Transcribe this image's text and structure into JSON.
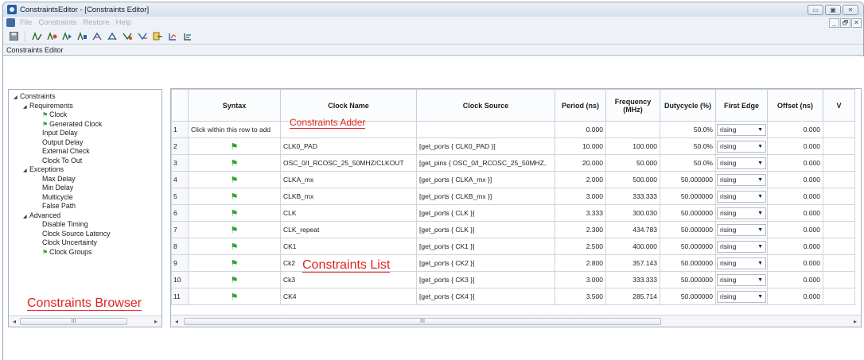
{
  "window": {
    "title": "ConstraintsEditor - [Constraints Editor]",
    "controls": [
      "▭",
      "▣",
      "✕"
    ],
    "mdi_controls": [
      "_",
      "🗗",
      "✕"
    ]
  },
  "menu": [
    "File",
    "Constraints",
    "Restore",
    "Help"
  ],
  "toolbar_icons": [
    "save-icon",
    "tool-1-icon",
    "tool-2-icon",
    "tool-3-icon",
    "tool-4-icon",
    "tool-5-icon",
    "tool-6-icon",
    "tool-7-icon",
    "tool-8-icon",
    "tool-9-icon",
    "tool-10-icon",
    "tool-11-icon"
  ],
  "editor_label": "Constraints Editor",
  "tree": [
    {
      "label": "Constraints",
      "indent": 0,
      "expander": "◢",
      "flag": false
    },
    {
      "label": "Requirements",
      "indent": 1,
      "expander": "◢",
      "flag": false
    },
    {
      "label": "Clock",
      "indent": 3,
      "expander": "",
      "flag": true
    },
    {
      "label": "Generated Clock",
      "indent": 3,
      "expander": "",
      "flag": true
    },
    {
      "label": "Input Delay",
      "indent": 3,
      "expander": "",
      "flag": false
    },
    {
      "label": "Output Delay",
      "indent": 3,
      "expander": "",
      "flag": false
    },
    {
      "label": "External Check",
      "indent": 3,
      "expander": "",
      "flag": false
    },
    {
      "label": "Clock To Out",
      "indent": 3,
      "expander": "",
      "flag": false
    },
    {
      "label": "Exceptions",
      "indent": 1,
      "expander": "◢",
      "flag": false
    },
    {
      "label": "Max Delay",
      "indent": 3,
      "expander": "",
      "flag": false
    },
    {
      "label": "Min Delay",
      "indent": 3,
      "expander": "",
      "flag": false
    },
    {
      "label": "Multicycle",
      "indent": 3,
      "expander": "",
      "flag": false
    },
    {
      "label": "False Path",
      "indent": 3,
      "expander": "",
      "flag": false
    },
    {
      "label": "Advanced",
      "indent": 1,
      "expander": "◢",
      "flag": false
    },
    {
      "label": "Disable Timing",
      "indent": 3,
      "expander": "",
      "flag": false
    },
    {
      "label": "Clock Source Latency",
      "indent": 3,
      "expander": "",
      "flag": false
    },
    {
      "label": "Clock Uncertainty",
      "indent": 3,
      "expander": "",
      "flag": false
    },
    {
      "label": "Clock Groups",
      "indent": 3,
      "expander": "",
      "flag": true
    }
  ],
  "annotations": {
    "browser": "Constraints Browser",
    "adder": "Constraints Adder",
    "list": "Constraints List"
  },
  "scroll_thumb": "III",
  "table": {
    "columns": [
      "Syntax",
      "Clock Name",
      "Clock Source",
      "Period  (ns)",
      "Frequency (MHz)",
      "Dutycycle (%)",
      "First Edge",
      "Offset (ns)",
      "V"
    ],
    "rows": [
      {
        "n": "1",
        "syntax": "Click within this row to add",
        "flag": false,
        "name": "",
        "source": "",
        "period": "0.000",
        "freq": "",
        "duty": "50.0%",
        "edge": "rising",
        "offset": "0.000"
      },
      {
        "n": "2",
        "syntax": "",
        "flag": true,
        "name": "CLK0_PAD",
        "source": "[get_ports { CLK0_PAD }]",
        "period": "10.000",
        "freq": "100.000",
        "duty": "50.0%",
        "edge": "rising",
        "offset": "0.000"
      },
      {
        "n": "3",
        "syntax": "",
        "flag": true,
        "name": "OSC_0/I_RCOSC_25_50MHZ/CLKOUT",
        "source": "[get_pins { OSC_0/I_RCOSC_25_50MHZ,",
        "period": "20.000",
        "freq": "50.000",
        "duty": "50.0%",
        "edge": "rising",
        "offset": "0.000"
      },
      {
        "n": "4",
        "syntax": "",
        "flag": true,
        "name": "CLKA_mx",
        "source": "[get_ports { CLKA_mx }]",
        "period": "2.000",
        "freq": "500.000",
        "duty": "50.000000",
        "edge": "rising",
        "offset": "0.000"
      },
      {
        "n": "5",
        "syntax": "",
        "flag": true,
        "name": "CLKB_mx",
        "source": "[get_ports { CLKB_mx }]",
        "period": "3.000",
        "freq": "333.333",
        "duty": "50.000000",
        "edge": "rising",
        "offset": "0.000"
      },
      {
        "n": "6",
        "syntax": "",
        "flag": true,
        "name": "CLK",
        "source": "[get_ports { CLK }]",
        "period": "3.333",
        "freq": "300.030",
        "duty": "50.000000",
        "edge": "rising",
        "offset": "0.000"
      },
      {
        "n": "7",
        "syntax": "",
        "flag": true,
        "name": "CLK_repeat",
        "source": "[get_ports { CLK }]",
        "period": "2.300",
        "freq": "434.783",
        "duty": "50.000000",
        "edge": "rising",
        "offset": "0.000"
      },
      {
        "n": "8",
        "syntax": "",
        "flag": true,
        "name": "CK1",
        "source": "[get_ports { CK1 }]",
        "period": "2.500",
        "freq": "400.000",
        "duty": "50.000000",
        "edge": "rising",
        "offset": "0.000"
      },
      {
        "n": "9",
        "syntax": "",
        "flag": true,
        "name": "Ck2",
        "source": "[get_ports { CK2 }]",
        "period": "2.800",
        "freq": "357.143",
        "duty": "50.000000",
        "edge": "rising",
        "offset": "0.000"
      },
      {
        "n": "10",
        "syntax": "",
        "flag": true,
        "name": "Ck3",
        "source": "[get_ports { CK3 }]",
        "period": "3.000",
        "freq": "333.333",
        "duty": "50.000000",
        "edge": "rising",
        "offset": "0.000"
      },
      {
        "n": "11",
        "syntax": "",
        "flag": true,
        "name": "CK4",
        "source": "[get_ports { CK4 }]",
        "period": "3.500",
        "freq": "285.714",
        "duty": "50.000000",
        "edge": "rising",
        "offset": "0.000"
      }
    ]
  },
  "colors": {
    "annotation": "#e02020",
    "flag": "#36a12e",
    "title_bar": "#d5dfee"
  }
}
